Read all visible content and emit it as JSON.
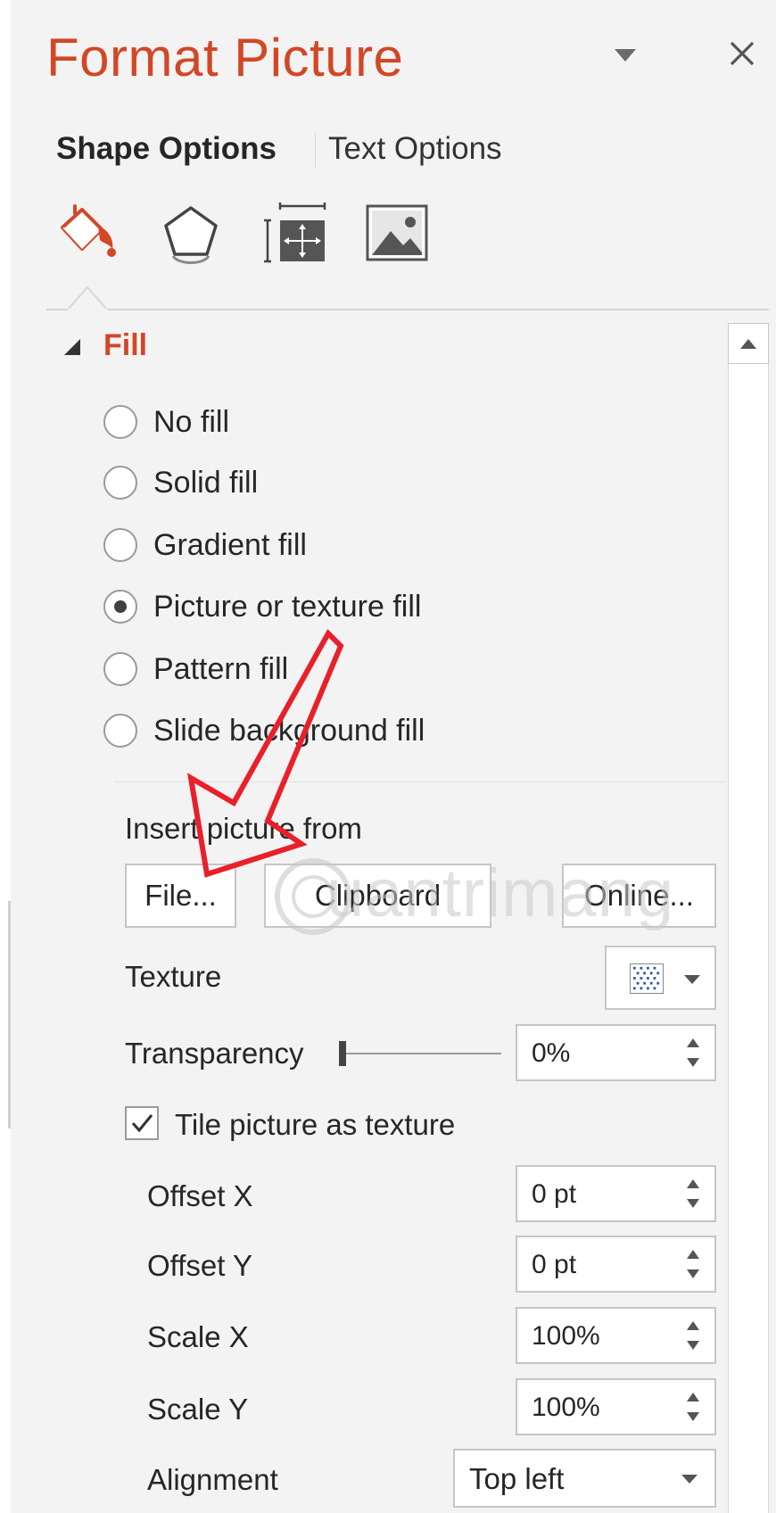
{
  "header": {
    "title": "Format Picture"
  },
  "tabs": {
    "shape_options": "Shape Options",
    "text_options": "Text Options"
  },
  "icon_tabs": [
    "fill-line-icon",
    "effects-icon",
    "size-properties-icon",
    "picture-icon"
  ],
  "fill": {
    "section_title": "Fill",
    "options": [
      {
        "label": "No fill",
        "checked": false
      },
      {
        "label": "Solid fill",
        "checked": false
      },
      {
        "label": "Gradient fill",
        "checked": false
      },
      {
        "label": "Picture or texture fill",
        "checked": true
      },
      {
        "label": "Pattern fill",
        "checked": false
      },
      {
        "label": "Slide background fill",
        "checked": false
      }
    ],
    "insert_from_label": "Insert picture from",
    "buttons": {
      "file": "File...",
      "clipboard": "Clipboard",
      "online": "Online..."
    },
    "texture_label": "Texture",
    "transparency_label": "Transparency",
    "transparency_value": "0%",
    "transparency_level": 0,
    "tile_label": "Tile picture as texture",
    "tile_checked": true,
    "offset_x_label": "Offset X",
    "offset_x_value": "0 pt",
    "offset_y_label": "Offset Y",
    "offset_y_value": "0 pt",
    "scale_x_label": "Scale X",
    "scale_x_value": "100%",
    "scale_y_label": "Scale Y",
    "scale_y_value": "100%",
    "alignment_label": "Alignment",
    "alignment_value": "Top left"
  },
  "watermark": "uantrimang",
  "colors": {
    "accent": "#d24726",
    "annotation_arrow": "#e8202a",
    "panel_bg": "#f3f3f3"
  }
}
